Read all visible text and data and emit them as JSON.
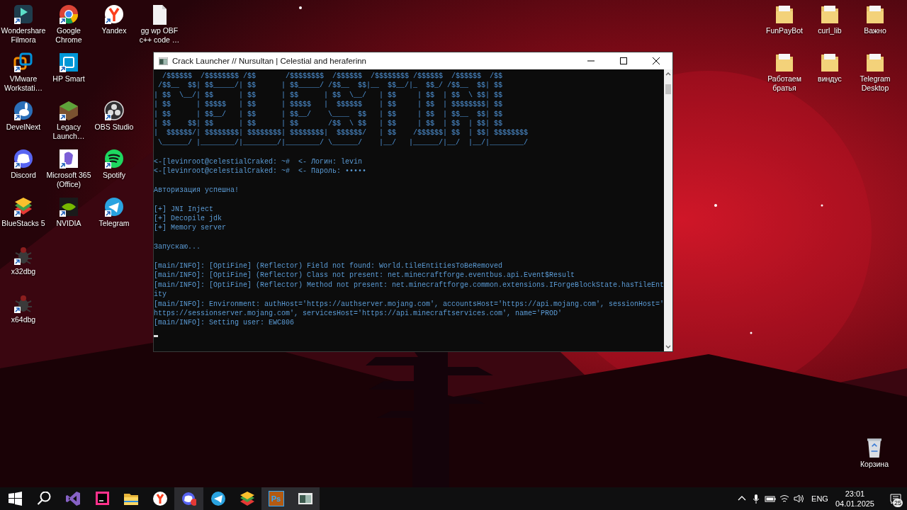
{
  "desktop_left": [
    {
      "icons": [
        {
          "label": "Wondershare Filmora",
          "kind": "filmora",
          "shortcut": true
        },
        {
          "label": "Google Chrome",
          "kind": "chrome",
          "shortcut": true
        },
        {
          "label": "Yandex",
          "kind": "yandex",
          "shortcut": true
        },
        {
          "label": "gg wp OBF c++ code …",
          "kind": "file",
          "shortcut": false
        }
      ]
    },
    {
      "icons": [
        {
          "label": "VMware Workstati…",
          "kind": "vmware",
          "shortcut": true
        },
        {
          "label": "HP Smart",
          "kind": "hp",
          "shortcut": true
        }
      ]
    },
    {
      "icons": [
        {
          "label": "DevelNext",
          "kind": "develnext",
          "shortcut": true
        },
        {
          "label": "Legacy Launch…",
          "kind": "minecraft",
          "shortcut": true
        },
        {
          "label": "OBS Studio",
          "kind": "obs",
          "shortcut": true
        }
      ]
    },
    {
      "icons": [
        {
          "label": "Discord",
          "kind": "discord",
          "shortcut": true
        },
        {
          "label": "Microsoft 365 (Office)",
          "kind": "m365",
          "shortcut": true
        },
        {
          "label": "Spotify",
          "kind": "spotify",
          "shortcut": true
        }
      ]
    },
    {
      "icons": [
        {
          "label": "BlueStacks 5",
          "kind": "bluestacks",
          "shortcut": true
        },
        {
          "label": "NVIDIA",
          "kind": "nvidia",
          "shortcut": true
        },
        {
          "label": "Telegram",
          "kind": "telegram",
          "shortcut": true
        }
      ]
    },
    {
      "icons": [
        {
          "label": "x32dbg",
          "kind": "bug",
          "shortcut": true
        }
      ]
    },
    {
      "icons": [
        {
          "label": "x64dbg",
          "kind": "bug",
          "shortcut": true
        }
      ]
    }
  ],
  "desktop_right": [
    {
      "icons": [
        {
          "label": "FunPayBot",
          "kind": "folder",
          "shortcut": false
        },
        {
          "label": "curl_lib",
          "kind": "folder",
          "shortcut": false
        },
        {
          "label": "Важно",
          "kind": "folder",
          "shortcut": false
        }
      ]
    },
    {
      "icons": [
        {
          "label": "Работаем братья",
          "kind": "folder",
          "shortcut": false
        },
        {
          "label": "виндус",
          "kind": "folder",
          "shortcut": false
        },
        {
          "label": "Telegram Desktop",
          "kind": "folder",
          "shortcut": false
        }
      ]
    }
  ],
  "recycle_bin": {
    "label": "Корзина"
  },
  "console_window": {
    "title": "Crack Launcher // Nursultan | Celestial and heraferinn",
    "banner": [
      "  /$$$$$$  /$$$$$$$$ /$$       /$$$$$$$$  /$$$$$$  /$$$$$$$$ /$$$$$$  /$$$$$$  /$$",
      " /$$__  $$| $$_____/| $$      | $$_____/ /$$__  $$|__  $$__/|_  $$_/ /$$__  $$| $$",
      "| $$  \\__/| $$      | $$      | $$      | $$  \\__/   | $$     | $$  | $$  \\ $$| $$",
      "| $$      | $$$$$   | $$      | $$$$$   |  $$$$$$    | $$     | $$  | $$$$$$$$| $$",
      "| $$      | $$__/   | $$      | $$__/    \\____  $$   | $$     | $$  | $$__  $$| $$",
      "| $$    $$| $$      | $$      | $$       /$$  \\ $$   | $$     | $$  | $$  | $$| $$",
      "|  $$$$$$/| $$$$$$$$| $$$$$$$$| $$$$$$$$|  $$$$$$/   | $$    /$$$$$$| $$  | $$| $$$$$$$$",
      " \\______/ |________/|________/|________/ \\______/    |__/   |______/|__/  |__/|________/"
    ],
    "blocks": [
      [
        "<-[levinroot@celestialCraked: ~#  <- Логин: levin",
        "<-[levinroot@celestialCraked: ~#  <- Пароль: •••••"
      ],
      [
        "Авторизация успешна!"
      ],
      [
        "[+] JNI Inject",
        "[+] Decopile jdk",
        "[+] Memory server"
      ],
      [
        "Запускаю..."
      ],
      [
        "[main/INFO]: [OptiFine] (Reflector) Field not found: World.tileEntitiesToBeRemoved",
        "[main/INFO]: [OptiFine] (Reflector) Class not present: net.minecraftforge.eventbus.api.Event$Result",
        "[main/INFO]: [OptiFine] (Reflector) Method not present: net.minecraftforge.common.extensions.IForgeBlockState.hasTileEnt",
        "ity",
        "[main/INFO]: Environment: authHost='https://authserver.mojang.com', accountsHost='https://api.mojang.com', sessionHost='",
        "https://sessionserver.mojang.com', servicesHost='https://api.minecraftservices.com', name='PROD'",
        "[main/INFO]: Setting user: EWC806"
      ]
    ]
  },
  "taskbar": {
    "apps": [
      {
        "kind": "windows",
        "active": false
      },
      {
        "kind": "search",
        "active": false
      },
      {
        "kind": "vs",
        "active": false
      },
      {
        "kind": "jetbrains",
        "active": false
      },
      {
        "kind": "explorer",
        "active": false
      },
      {
        "kind": "yandex",
        "active": false
      },
      {
        "kind": "discord",
        "active": true
      },
      {
        "kind": "telegram",
        "active": false
      },
      {
        "kind": "bluestacks",
        "active": false
      },
      {
        "kind": "photoshop",
        "glyph": "Ps",
        "active": true
      },
      {
        "kind": "console",
        "active": true
      }
    ],
    "language": "ENG",
    "time": "23:01",
    "date": "04.01.2025",
    "notifications": "25"
  }
}
